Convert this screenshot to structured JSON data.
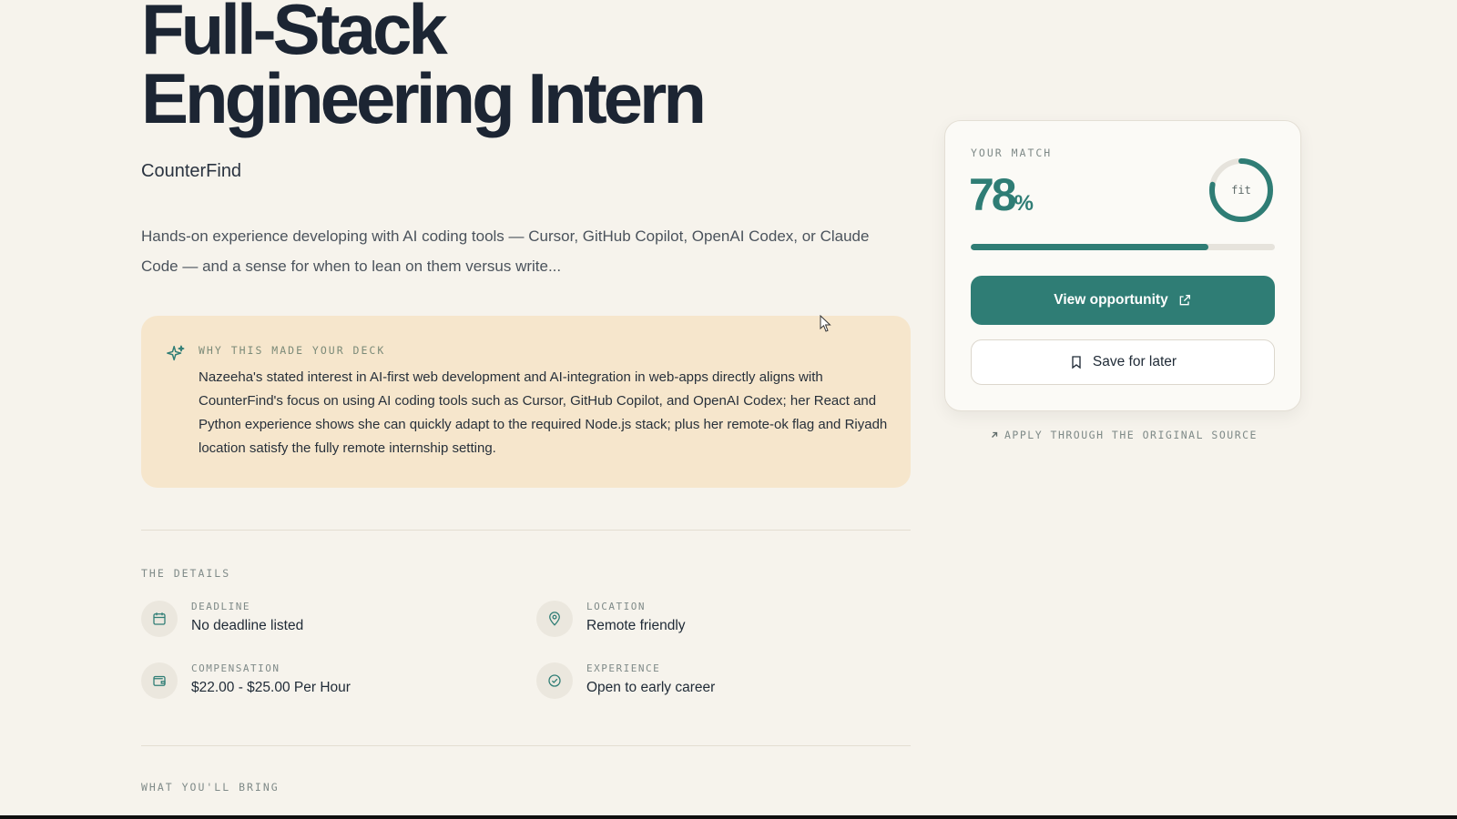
{
  "job": {
    "title": "Full-Stack\nEngineering Intern",
    "company": "CounterFind",
    "summary": "Hands-on experience developing with AI coding tools — Cursor, GitHub Copilot, OpenAI Codex, or Claude Code — and a sense for when to lean on them versus write..."
  },
  "why": {
    "heading": "WHY THIS MADE YOUR DECK",
    "icon": "sparkle-icon",
    "text": "Nazeeha's stated interest in AI-first web development and AI-integration in web-apps directly aligns with CounterFind's focus on using AI coding tools such as Cursor, GitHub Copilot, and OpenAI Codex; her React and Python experience shows she can quickly adapt to the required Node.js stack; plus her remote-ok flag and Riyadh location satisfy the fully remote internship setting."
  },
  "details": {
    "heading": "THE DETAILS",
    "items": [
      {
        "label": "DEADLINE",
        "value": "No deadline listed",
        "icon": "calendar-icon"
      },
      {
        "label": "LOCATION",
        "value": "Remote friendly",
        "icon": "location-pin-icon"
      },
      {
        "label": "COMPENSATION",
        "value": "$22.00 - $25.00 Per Hour",
        "icon": "wallet-icon"
      },
      {
        "label": "EXPERIENCE",
        "value": "Open to early career",
        "icon": "check-circle-icon"
      }
    ]
  },
  "bring": {
    "heading": "WHAT YOU'LL BRING"
  },
  "match": {
    "label": "YOUR MATCH",
    "score": "78",
    "score_suffix": "%",
    "fraction": 0.78,
    "ring_label": "fit",
    "view_label": "View opportunity",
    "save_label": "Save for later",
    "apply_note": "APPLY THROUGH THE ORIGINAL SOURCE"
  },
  "colors": {
    "accent": "#2f7d75",
    "background": "#f6f3ec",
    "highlight_card": "#f6e6cc"
  }
}
